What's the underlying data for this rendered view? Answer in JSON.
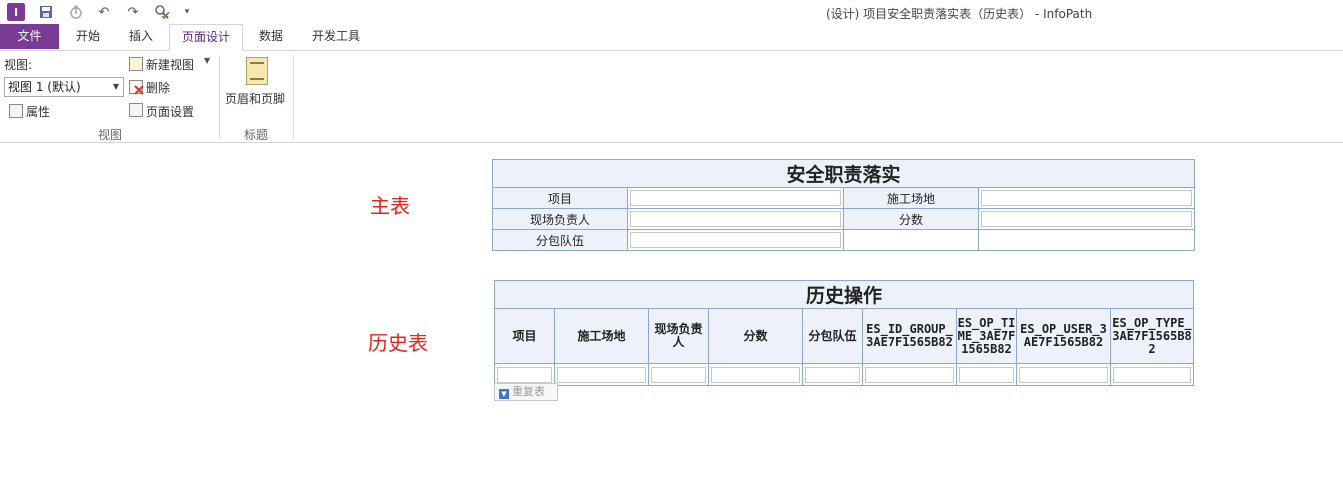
{
  "window": {
    "title": "(设计) 项目安全职责落实表（历史表） - InfoPath"
  },
  "tabs": [
    {
      "label": "文件"
    },
    {
      "label": "开始"
    },
    {
      "label": "插入"
    },
    {
      "label": "页面设计"
    },
    {
      "label": "数据"
    },
    {
      "label": "开发工具"
    }
  ],
  "ribbon": {
    "view_label": "视图:",
    "view_select_value": "视图 1 (默认)",
    "new_view": "新建视图",
    "delete": "删除",
    "properties": "属性",
    "page_setup": "页面设置",
    "group_view": "视图",
    "header_footer": "页眉和页脚",
    "group_title": "标题"
  },
  "canvas": {
    "main_label": "主表",
    "history_label": "历史表",
    "main_table": {
      "title": "安全职责落实",
      "rows": [
        [
          "项目",
          "施工场地"
        ],
        [
          "现场负责人",
          "分数"
        ],
        [
          "分包队伍",
          ""
        ]
      ]
    },
    "history_table": {
      "title": "历史操作",
      "columns": [
        "项目",
        "施工场地",
        "现场负责人",
        "分数",
        "分包队伍",
        "ES_ID_GROUP_3AE7F1565B82",
        "ES_OP_TIME_3AE7F1565B82",
        "ES_OP_USER_3AE7F1565B82",
        "ES_OP_TYPE_3AE7F1565B82"
      ]
    },
    "repeat_button": "重复表"
  }
}
